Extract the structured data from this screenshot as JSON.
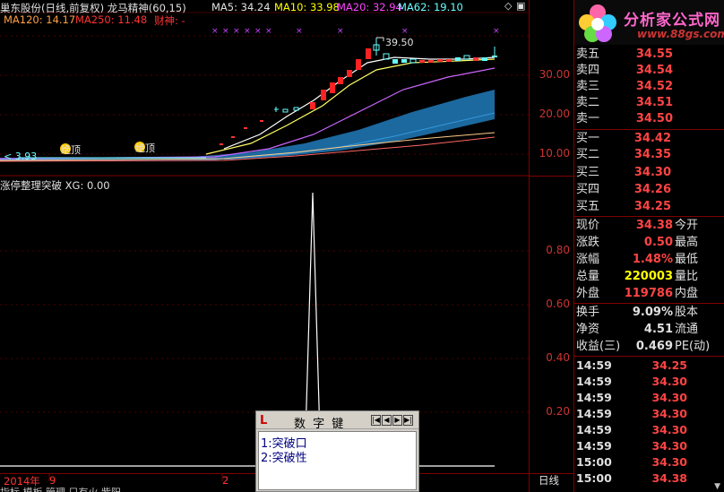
{
  "header": {
    "stock_title": "巢东股份(日线,前复权) 龙马精神(60,15)",
    "ma5": "MA5: 34.24",
    "ma10": "MA10: 33.98",
    "ma20": "MA20: 32.94",
    "ma62": "MA62: 19.10",
    "ma120": "MA120: 14.17",
    "ma250": "MA250: 11.48",
    "caishen": "财神: -"
  },
  "chart": {
    "price_axis": [
      "30.00",
      "20.00",
      "10.00"
    ],
    "peak_label": "39.50",
    "low_label": "3.93",
    "badge_labels": [
      "绝顶",
      "绝顶"
    ],
    "indicator_title": "涨停整理突破  XG: 0.00",
    "indicator_axis": [
      "0.80",
      "0.60",
      "0.40",
      "0.20"
    ],
    "date_year": "2014年",
    "date_marks": [
      "9",
      "2"
    ],
    "period": "日线",
    "tabs": "指标  模板  管理  只有火  紫阳"
  },
  "logo": {
    "text": "分析家公式网",
    "url": "www.88gs.com"
  },
  "order_book": {
    "asks": [
      {
        "label": "卖五",
        "price": "34.55"
      },
      {
        "label": "卖四",
        "price": "34.54"
      },
      {
        "label": "卖三",
        "price": "34.52"
      },
      {
        "label": "卖二",
        "price": "34.51"
      },
      {
        "label": "卖一",
        "price": "34.50"
      }
    ],
    "bids": [
      {
        "label": "买一",
        "price": "34.42"
      },
      {
        "label": "买二",
        "price": "34.35"
      },
      {
        "label": "买三",
        "price": "34.30"
      },
      {
        "label": "买四",
        "price": "34.26"
      },
      {
        "label": "买五",
        "price": "34.25"
      }
    ]
  },
  "quote": [
    {
      "label": "现价",
      "value": "34.38",
      "label2": "今开",
      "color": "#ff4444"
    },
    {
      "label": "涨跌",
      "value": "0.50",
      "label2": "最高",
      "color": "#ff4444"
    },
    {
      "label": "涨幅",
      "value": "1.48%",
      "label2": "最低",
      "color": "#ff4444"
    },
    {
      "label": "总量",
      "value": "220003",
      "label2": "量比",
      "color": "#ffff00"
    },
    {
      "label": "外盘",
      "value": "119786",
      "label2": "内盘",
      "color": "#ff4444"
    }
  ],
  "stats": [
    {
      "label": "换手",
      "value": "9.09%",
      "label2": "股本"
    },
    {
      "label": "净资",
      "value": "4.51",
      "label2": "流通"
    },
    {
      "label": "收益(三)",
      "value": "0.469",
      "label2": "PE(动)"
    }
  ],
  "ticks": [
    {
      "time": "14:59",
      "price": "34.25"
    },
    {
      "time": "14:59",
      "price": "34.30"
    },
    {
      "time": "14:59",
      "price": "34.30"
    },
    {
      "time": "14:59",
      "price": "34.30"
    },
    {
      "time": "14:59",
      "price": "34.30"
    },
    {
      "time": "14:59",
      "price": "34.30"
    },
    {
      "time": "15:00",
      "price": "34.30"
    },
    {
      "time": "15:00",
      "price": "34.38"
    }
  ],
  "dialog": {
    "title": "数 字 键",
    "options": [
      "1:突破口",
      "2:突破性"
    ]
  }
}
